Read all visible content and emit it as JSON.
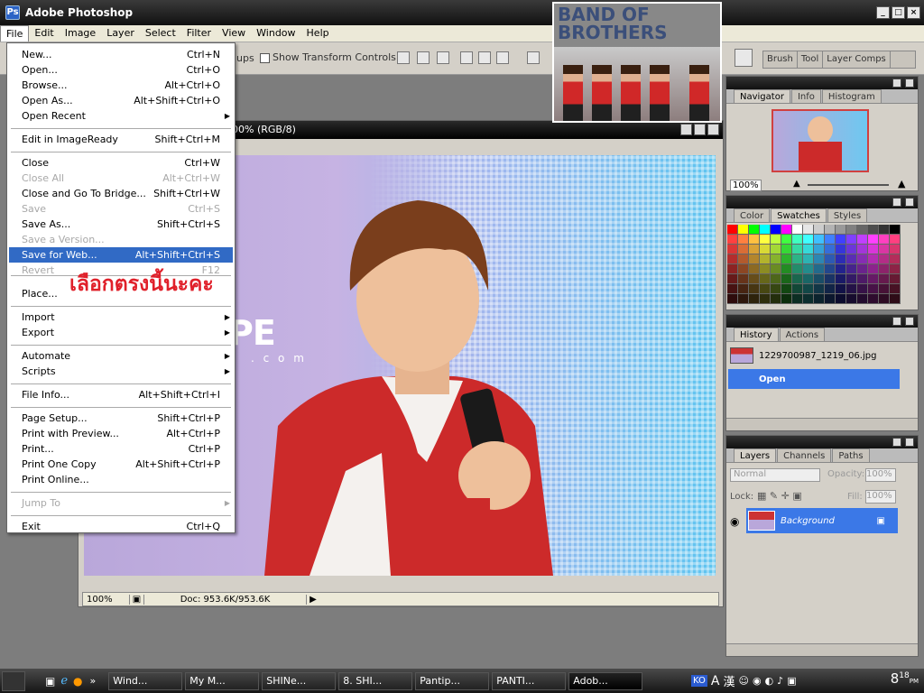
{
  "window": {
    "title": "Adobe Photoshop",
    "app_icon": "Ps"
  },
  "menubar": [
    "File",
    "Edit",
    "Image",
    "Layer",
    "Select",
    "Filter",
    "View",
    "Window",
    "Help"
  ],
  "options_bar": {
    "truncated_label": "ups",
    "show_transform_controls": "Show Transform Controls"
  },
  "palette_well": [
    "Brush",
    "Tool",
    "Layer Comps"
  ],
  "thumbnail_text": {
    "line1": "BAND OF",
    "line2": "BROTHERS"
  },
  "document": {
    "title_suffix": "00% (RGB/8)",
    "zoom": "100%",
    "doc_size": "Doc: 953.6K/953.6K",
    "watermark": "PE",
    "watermark_sub": ". c o m"
  },
  "file_menu": {
    "items": [
      {
        "label": "New...",
        "shortcut": "Ctrl+N"
      },
      {
        "label": "Open...",
        "shortcut": "Ctrl+O"
      },
      {
        "label": "Browse...",
        "shortcut": "Alt+Ctrl+O"
      },
      {
        "label": "Open As...",
        "shortcut": "Alt+Shift+Ctrl+O"
      },
      {
        "label": "Open Recent",
        "shortcut": ""
      },
      {
        "label": "Edit in ImageReady",
        "shortcut": "Shift+Ctrl+M"
      },
      {
        "label": "Close",
        "shortcut": "Ctrl+W"
      },
      {
        "label": "Close All",
        "shortcut": "Alt+Ctrl+W"
      },
      {
        "label": "Close and Go To Bridge...",
        "shortcut": "Shift+Ctrl+W"
      },
      {
        "label": "Save",
        "shortcut": "Ctrl+S"
      },
      {
        "label": "Save As...",
        "shortcut": "Shift+Ctrl+S"
      },
      {
        "label": "Save a Version...",
        "shortcut": ""
      },
      {
        "label": "Save for Web...",
        "shortcut": "Alt+Shift+Ctrl+S"
      },
      {
        "label": "Revert",
        "shortcut": "F12"
      },
      {
        "label": "Place...",
        "shortcut": ""
      },
      {
        "label": "Import",
        "shortcut": ""
      },
      {
        "label": "Export",
        "shortcut": ""
      },
      {
        "label": "Automate",
        "shortcut": ""
      },
      {
        "label": "Scripts",
        "shortcut": ""
      },
      {
        "label": "File Info...",
        "shortcut": "Alt+Shift+Ctrl+I"
      },
      {
        "label": "Page Setup...",
        "shortcut": "Shift+Ctrl+P"
      },
      {
        "label": "Print with Preview...",
        "shortcut": "Alt+Ctrl+P"
      },
      {
        "label": "Print...",
        "shortcut": "Ctrl+P"
      },
      {
        "label": "Print One Copy",
        "shortcut": "Alt+Shift+Ctrl+P"
      },
      {
        "label": "Print Online...",
        "shortcut": ""
      },
      {
        "label": "Jump To",
        "shortcut": ""
      },
      {
        "label": "Exit",
        "shortcut": "Ctrl+Q"
      }
    ],
    "annotation": "เลือกตรงนี้นะคะ"
  },
  "navigator": {
    "tabs": [
      "Navigator",
      "Info",
      "Histogram"
    ],
    "zoom": "100%"
  },
  "color_panel": {
    "tabs": [
      "Color",
      "Swatches",
      "Styles"
    ]
  },
  "history": {
    "tabs": [
      "History",
      "Actions"
    ],
    "snapshot": "1229700987_1219_06.jpg",
    "step": "Open"
  },
  "layers": {
    "tabs": [
      "Layers",
      "Channels",
      "Paths"
    ],
    "blend_mode": "Normal",
    "opacity_label": "Opacity:",
    "opacity": "100%",
    "lock_label": "Lock:",
    "fill_label": "Fill:",
    "fill": "100%",
    "layer_name": "Background"
  },
  "taskbar": {
    "items": [
      "Wind...",
      "My M...",
      "SHINe...",
      "8. SHI...",
      "Pantip...",
      "PANTI...",
      "Adob..."
    ],
    "lang": "KO",
    "time": "8",
    "time_small": "18",
    "ampm": "PM",
    "tray_chars": [
      "A",
      "漢"
    ]
  },
  "colors": {
    "highlight": "#316ac5",
    "selection_blue": "#3b78e7",
    "annotation_red": "#e0202a"
  }
}
